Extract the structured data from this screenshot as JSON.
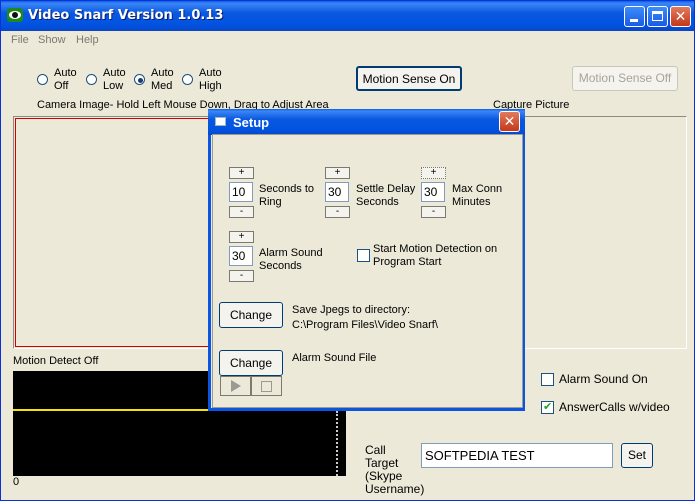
{
  "window": {
    "title": "Video Snarf Version 1.0.13",
    "menu": [
      "File",
      "Show",
      "Help"
    ]
  },
  "sensitivity": {
    "options": [
      {
        "line1": "Auto",
        "line2": "Off",
        "checked": false
      },
      {
        "line1": "Auto",
        "line2": "Low",
        "checked": false
      },
      {
        "line1": "Auto",
        "line2": "Med",
        "checked": true
      },
      {
        "line1": "Auto",
        "line2": "High",
        "checked": false
      }
    ]
  },
  "buttons": {
    "motion_on": "Motion Sense On",
    "motion_off": "Motion Sense Off",
    "set": "Set"
  },
  "labels": {
    "camera_image": "Camera Image- Hold Left Mouse Down, Drag to Adjust Area",
    "capture_picture": "Capture Picture",
    "motion_detect": "Motion Detect Off",
    "graph_zero": "0",
    "alarm_sound_on": "Alarm Sound On",
    "answer_calls": "AnswerCalls w/video",
    "call_target": "Call Target (Skype Username)"
  },
  "checkboxes": {
    "alarm_sound_on": false,
    "answer_calls": true
  },
  "call_target_value": "SOFTPEDIA TEST",
  "setup": {
    "title": "Setup",
    "seconds_to_ring": {
      "value": "10",
      "label": "Seconds to Ring"
    },
    "settle_delay": {
      "value": "30",
      "label": "Settle Delay Seconds"
    },
    "max_conn": {
      "value": "30",
      "label": "Max Conn Minutes"
    },
    "alarm_sound_seconds": {
      "value": "30",
      "label": "Alarm Sound Seconds"
    },
    "start_motion": {
      "label": "Start Motion Detection on Program Start",
      "checked": false
    },
    "plus": "+",
    "minus": "-",
    "change": "Change",
    "save_jpegs_label": "Save Jpegs to directory:",
    "save_jpegs_path": "C:\\Program Files\\Video Snarf\\",
    "alarm_sound_file": "Alarm Sound File"
  },
  "colors": {
    "titlebar": "#0054e3",
    "camera_border": "#d40000",
    "graph_bg": "#000000",
    "graph_line": "#f5e400"
  }
}
